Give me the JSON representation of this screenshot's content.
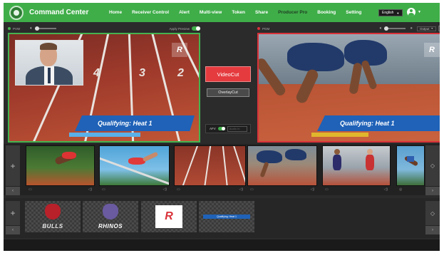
{
  "app": {
    "title": "Command Center"
  },
  "nav": {
    "items": [
      {
        "label": "Home",
        "active": false
      },
      {
        "label": "Receiver Control",
        "active": false
      },
      {
        "label": "Alert",
        "active": false
      },
      {
        "label": "Multi-view",
        "active": false
      },
      {
        "label": "Token",
        "active": false
      },
      {
        "label": "Share",
        "active": false
      },
      {
        "label": "Producer Pro",
        "active": true
      },
      {
        "label": "Booking",
        "active": false
      },
      {
        "label": "Setting",
        "active": false
      }
    ],
    "language": "English",
    "user_icon": "user-avatar-icon"
  },
  "preview_bar": {
    "label": "PVW",
    "apply_preview_label": "Apply Preview",
    "apply_preview_on": true
  },
  "program_bar": {
    "label": "PGM",
    "output_label": "Output"
  },
  "preview": {
    "lower_third_text": "Qualifying: Heat 1",
    "lane_numbers": [
      "4",
      "3",
      "2"
    ]
  },
  "program": {
    "lower_third_text": "Qualifying: Heat 1"
  },
  "controls": {
    "videocut_label": "VideoCut",
    "overlaycut_label": "OverlayCut",
    "afv_label": "AFV",
    "afv_select_placeholder": "Audio In"
  },
  "video_sources": [
    {
      "name": "high-jump"
    },
    {
      "name": "hurdle-jump"
    },
    {
      "name": "track-lanes"
    },
    {
      "name": "sprint-start"
    },
    {
      "name": "relay-baton"
    },
    {
      "name": "high-jump-2"
    }
  ],
  "graphics": [
    {
      "name": "bulls-logo",
      "text": "BULLS"
    },
    {
      "name": "rhinos-logo",
      "text": "RHINOS"
    },
    {
      "name": "r-logo",
      "text": "R"
    },
    {
      "name": "lower-third",
      "text": "Qualifying: Heat 1"
    }
  ],
  "colors": {
    "nav_green": "#3fae49",
    "preview_border": "#45b34f",
    "program_border": "#d9323a",
    "cut_red": "#e53b3f",
    "lower_third_blue": "#1f62b8"
  }
}
